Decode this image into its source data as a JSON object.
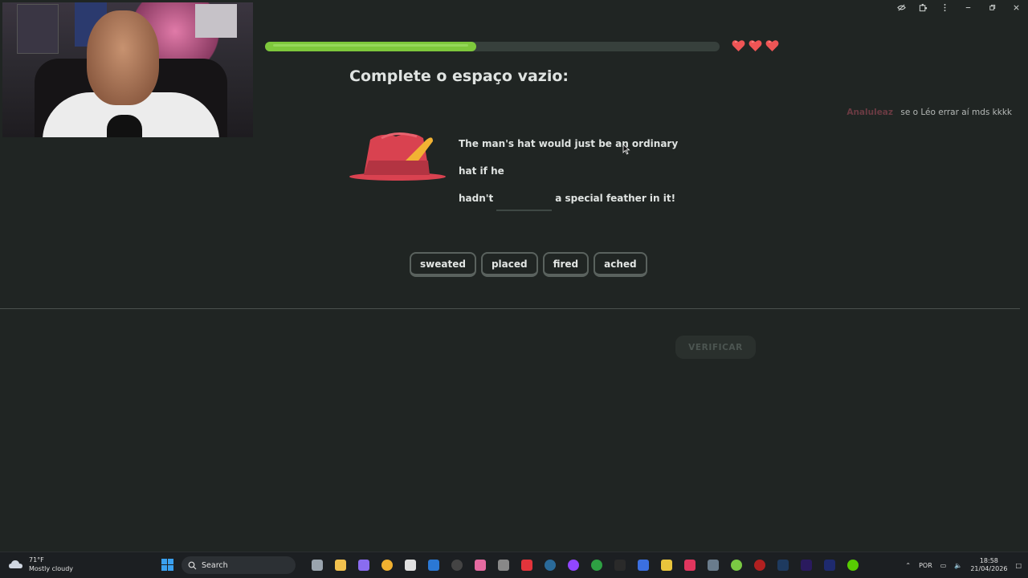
{
  "window": {
    "controls": [
      "eye-off-icon",
      "extension-icon",
      "more-icon",
      "minimize-icon",
      "restore-icon",
      "close-icon"
    ]
  },
  "lesson": {
    "progress_fraction": 0.465,
    "hearts": 3,
    "title": "Complete o espaço vazio:",
    "sentence_line1": "The man's hat would just be an ordinary hat if he",
    "sentence_before_blank": "hadn't",
    "sentence_after_blank": "a special feather in it!",
    "options": [
      "sweated",
      "placed",
      "fired",
      "ached"
    ],
    "verify_label": "VERIFICAR"
  },
  "chat": {
    "user": "Analuleaz",
    "message": "se o Léo errar aí mds kkkk"
  },
  "taskbar": {
    "weather_temp": "71°F",
    "weather_desc": "Mostly cloudy",
    "search_label": "Search",
    "language": "POR",
    "time": "18:58",
    "date": "21/04/2026"
  },
  "colors": {
    "accent_green": "#7ec83c",
    "heart_red": "#ee5555",
    "background": "#202523"
  }
}
